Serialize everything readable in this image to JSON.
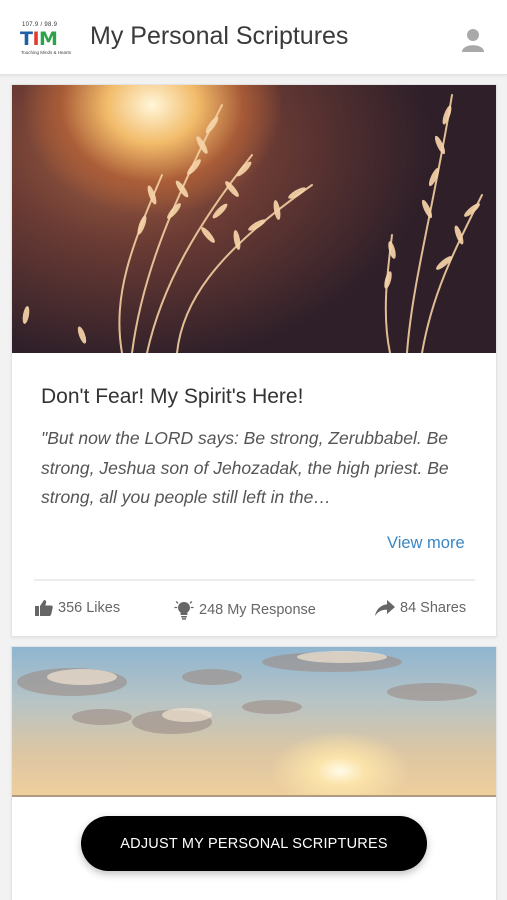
{
  "header": {
    "logo": {
      "brand_text": "TIM",
      "frequency": "107.9 / 98.9",
      "tagline": "Touching Minds & Hearts"
    },
    "title": "My Personal Scriptures",
    "profile_icon": "user-icon"
  },
  "cards": [
    {
      "image_icon": "wheat-field-sunset-image",
      "title": "Don't Fear! My Spirit's Here!",
      "excerpt": "\"But now the LORD says: Be strong, Zerubbabel. Be strong, Jeshua son of Jehozadak, the high priest. Be strong, all you people still left in the…",
      "view_more": "View more",
      "stats": {
        "likes": {
          "icon": "thumbs-up-icon",
          "label": "356 Likes"
        },
        "response": {
          "icon": "lightbulb-icon",
          "label": "248 My Response"
        },
        "shares": {
          "icon": "share-icon",
          "label": "84 Shares"
        }
      }
    },
    {
      "image_icon": "sunset-sky-image"
    }
  ],
  "cta": {
    "label": "ADJUST MY PERSONAL SCRIPTURES"
  },
  "colors": {
    "link": "#3a86c4",
    "cta_background": "#000000",
    "text": "#333333"
  }
}
